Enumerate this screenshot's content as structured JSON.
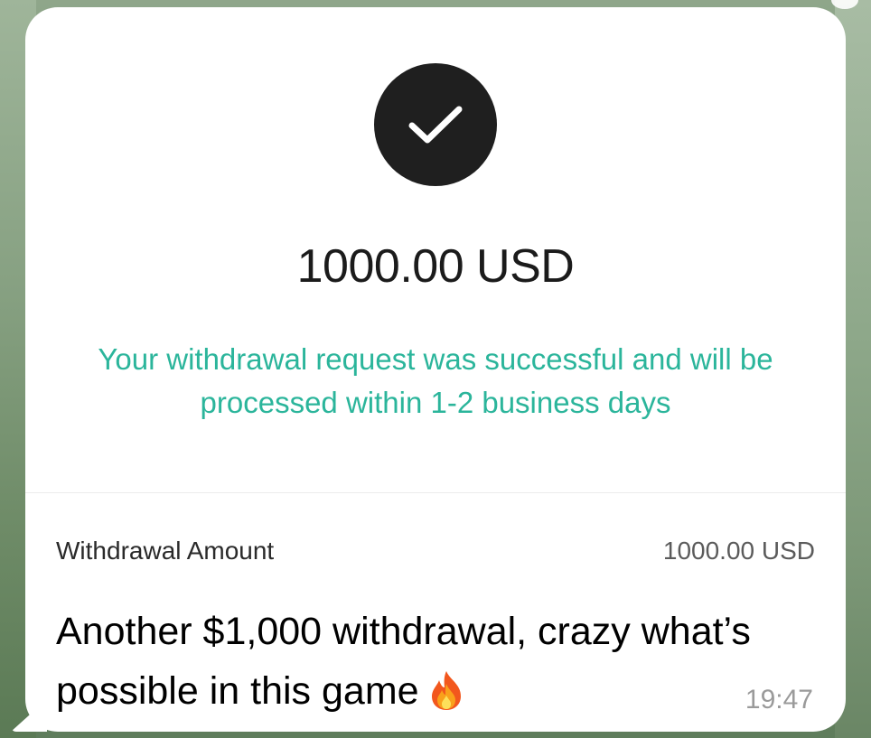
{
  "receipt": {
    "amount_title": "1000.00 USD",
    "success_message": "Your withdrawal request was successful and will be processed within 1-2 business days",
    "detail_label": "Withdrawal Amount",
    "detail_value": "1000.00 USD",
    "accent_color": "#2bb59b"
  },
  "message": {
    "caption_text": "Another $1,000 withdrawal, crazy what’s possible in this game",
    "emoji_icon": "fire-icon",
    "timestamp": "19:47"
  }
}
